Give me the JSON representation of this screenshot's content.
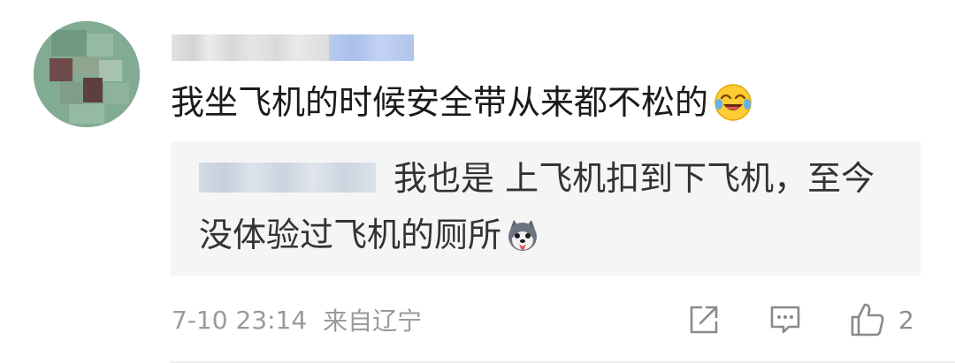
{
  "comment": {
    "text": "我坐飞机的时候安全带从来都不松的",
    "emoji": "laughing-crying-emoji"
  },
  "reply": {
    "line1": "我也是 上飞机扣到下飞机，至今",
    "line2": "没体验过飞机的厕所",
    "emoji": "husky-dog-emoji"
  },
  "meta": {
    "datetime": "7-10 23:14",
    "location": "来自辽宁"
  },
  "actions": {
    "share_icon": "share-icon",
    "comment_icon": "comment-icon",
    "like_icon": "thumbs-up-icon",
    "like_count": "2"
  },
  "colors": {
    "reply_background": "#f5f5f5",
    "meta_text": "#9a9a9a",
    "username_badge": "#b9ccef"
  }
}
